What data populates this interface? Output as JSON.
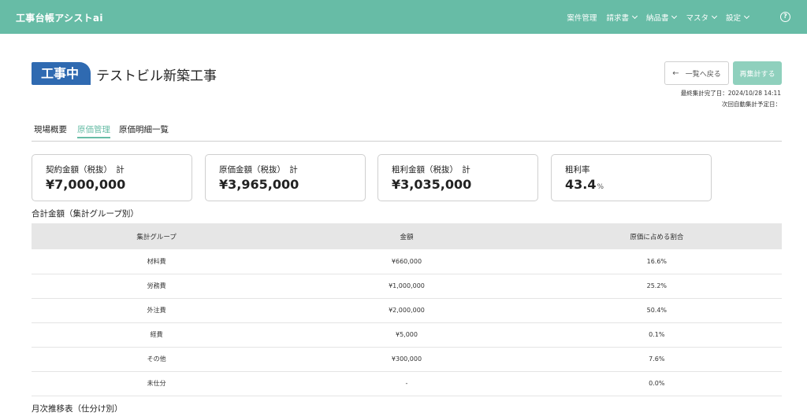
{
  "header": {
    "app_title": "工事台帳アシストai",
    "nav": [
      {
        "label": "案件管理",
        "dropdown": false
      },
      {
        "label": "請求書",
        "dropdown": true
      },
      {
        "label": "納品書",
        "dropdown": true
      },
      {
        "label": "マスタ",
        "dropdown": true
      },
      {
        "label": "設定",
        "dropdown": true
      }
    ],
    "help_icon": "?"
  },
  "project": {
    "status": "工事中",
    "title": "テストビル新築工事"
  },
  "actions": {
    "back_label": "一覧へ戻る",
    "recalc_label": "再集計する"
  },
  "meta": {
    "last_aggregated": "最終集計完了日：2024/10/28 14:11",
    "next_auto": "次回自動集計予定日："
  },
  "tabs": [
    {
      "label": "現場概要",
      "active": false
    },
    {
      "label": "原価管理",
      "active": true
    },
    {
      "label": "原価明細一覧",
      "active": false
    }
  ],
  "cards": [
    {
      "label": "契約金額（税抜）　計",
      "value": "¥7,000,000",
      "unit": ""
    },
    {
      "label": "原価金額（税抜）　計",
      "value": "¥3,965,000",
      "unit": ""
    },
    {
      "label": "粗利金額（税抜）　計",
      "value": "¥3,035,000",
      "unit": ""
    },
    {
      "label": "粗利率",
      "value": "43.4",
      "unit": "%"
    }
  ],
  "summary": {
    "title": "合計金額（集計グループ別）",
    "headers": [
      "集計グループ",
      "金額",
      "原価に占める割合"
    ],
    "rows": [
      [
        "材料費",
        "¥660,000",
        "16.6%"
      ],
      [
        "労務費",
        "¥1,000,000",
        "25.2%"
      ],
      [
        "外注費",
        "¥2,000,000",
        "50.4%"
      ],
      [
        "経費",
        "¥5,000",
        "0.1%"
      ],
      [
        "その他",
        "¥300,000",
        "7.6%"
      ],
      [
        "未仕分",
        "-",
        "0.0%"
      ]
    ]
  },
  "monthly": {
    "title": "月次推移表（仕分け別）"
  },
  "colors": {
    "brand": "#67bca6",
    "status_badge": "#2f6ab1",
    "recalc_button": "#8fd0bd"
  }
}
